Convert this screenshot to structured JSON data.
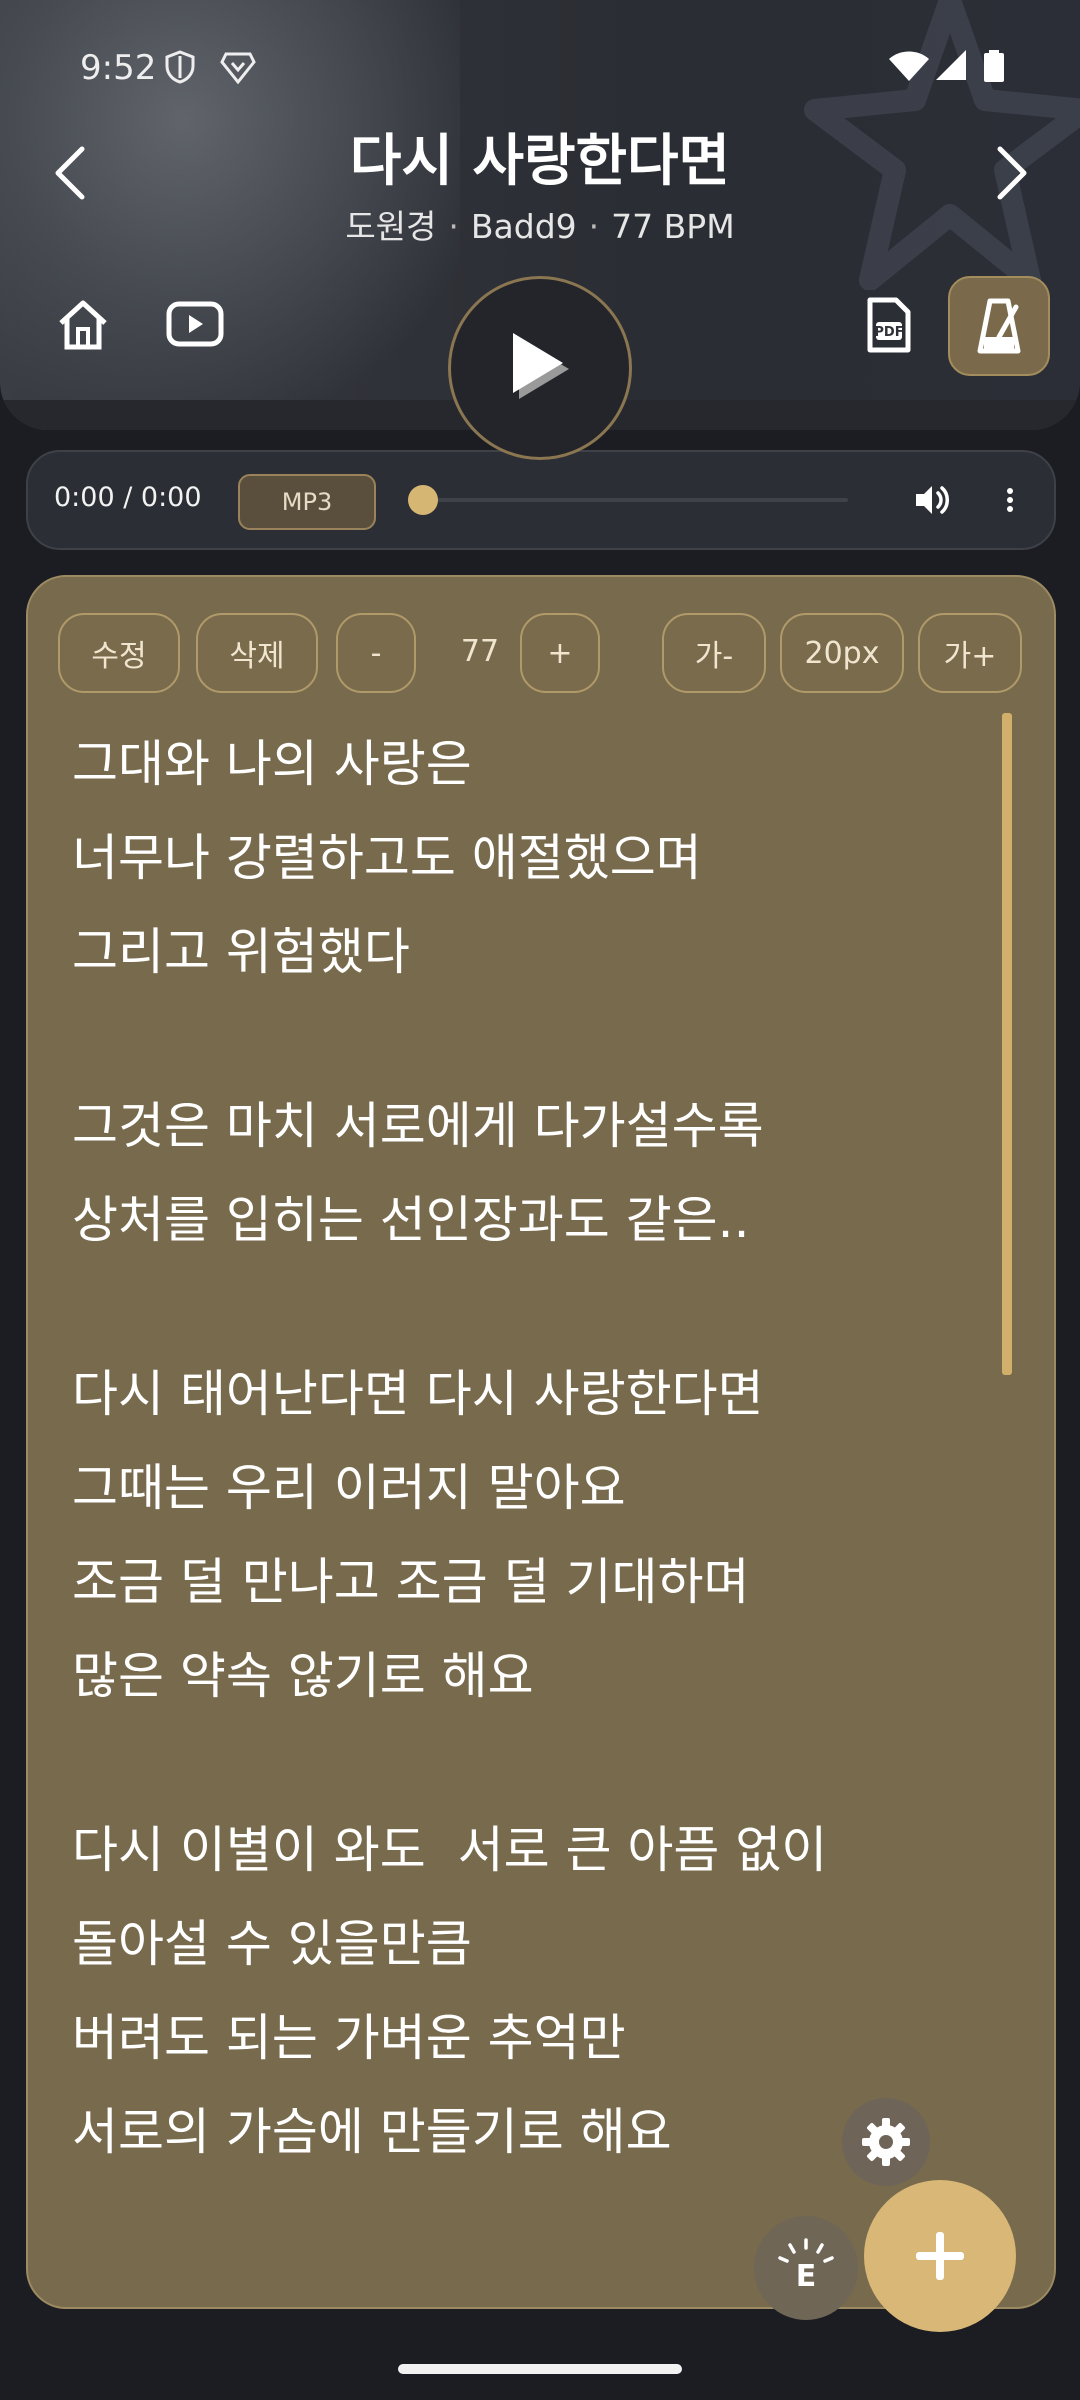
{
  "status_bar": {
    "time": "9:52"
  },
  "song": {
    "title": "다시 사랑한다면",
    "artist": "도원경",
    "key": "Badd9",
    "bpm_label": "77 BPM"
  },
  "header_icons": {
    "prev": "chevron-left-icon",
    "next": "chevron-right-icon",
    "home": "home-icon",
    "youtube": "youtube-icon",
    "pdf": "pdf-file-icon",
    "metronome": "metronome-icon",
    "play": "play-icon"
  },
  "player": {
    "time": "0:00 / 0:00",
    "format_label": "MP3",
    "progress": 0
  },
  "toolbar": {
    "edit_label": "수정",
    "delete_label": "삭제",
    "bpm_minus": "-",
    "bpm_value": "77",
    "bpm_plus": "+",
    "font_decrease": "가-",
    "font_size": "20px",
    "font_increase": "가+"
  },
  "lyrics": [
    "그대와 나의 사랑은",
    "너무나 강렬하고도 애절했으며",
    "그리고 위험했다",
    "",
    "그것은 마치 서로에게 다가설수록",
    "상처를 입히는 선인장과도 같은..",
    "",
    "다시 태어난다면 다시 사랑한다면",
    "그때는 우리 이러지 말아요",
    "조금 덜 만나고 조금 덜 기대하며",
    "많은 약속 않기로 해요",
    "",
    "다시 이별이 와도  서로 큰 아픔 없이",
    "돌아설 수 있을만큼",
    "버려도 되는 가벼운 추억만",
    "서로의 가슴에 만들기로 해요"
  ],
  "fab": {
    "settings": "gear-icon",
    "effects": "E",
    "add": "plus-icon"
  },
  "colors": {
    "accent": "#d8b777",
    "card_bg": "#786a4c",
    "app_bg": "#1c1d22"
  }
}
